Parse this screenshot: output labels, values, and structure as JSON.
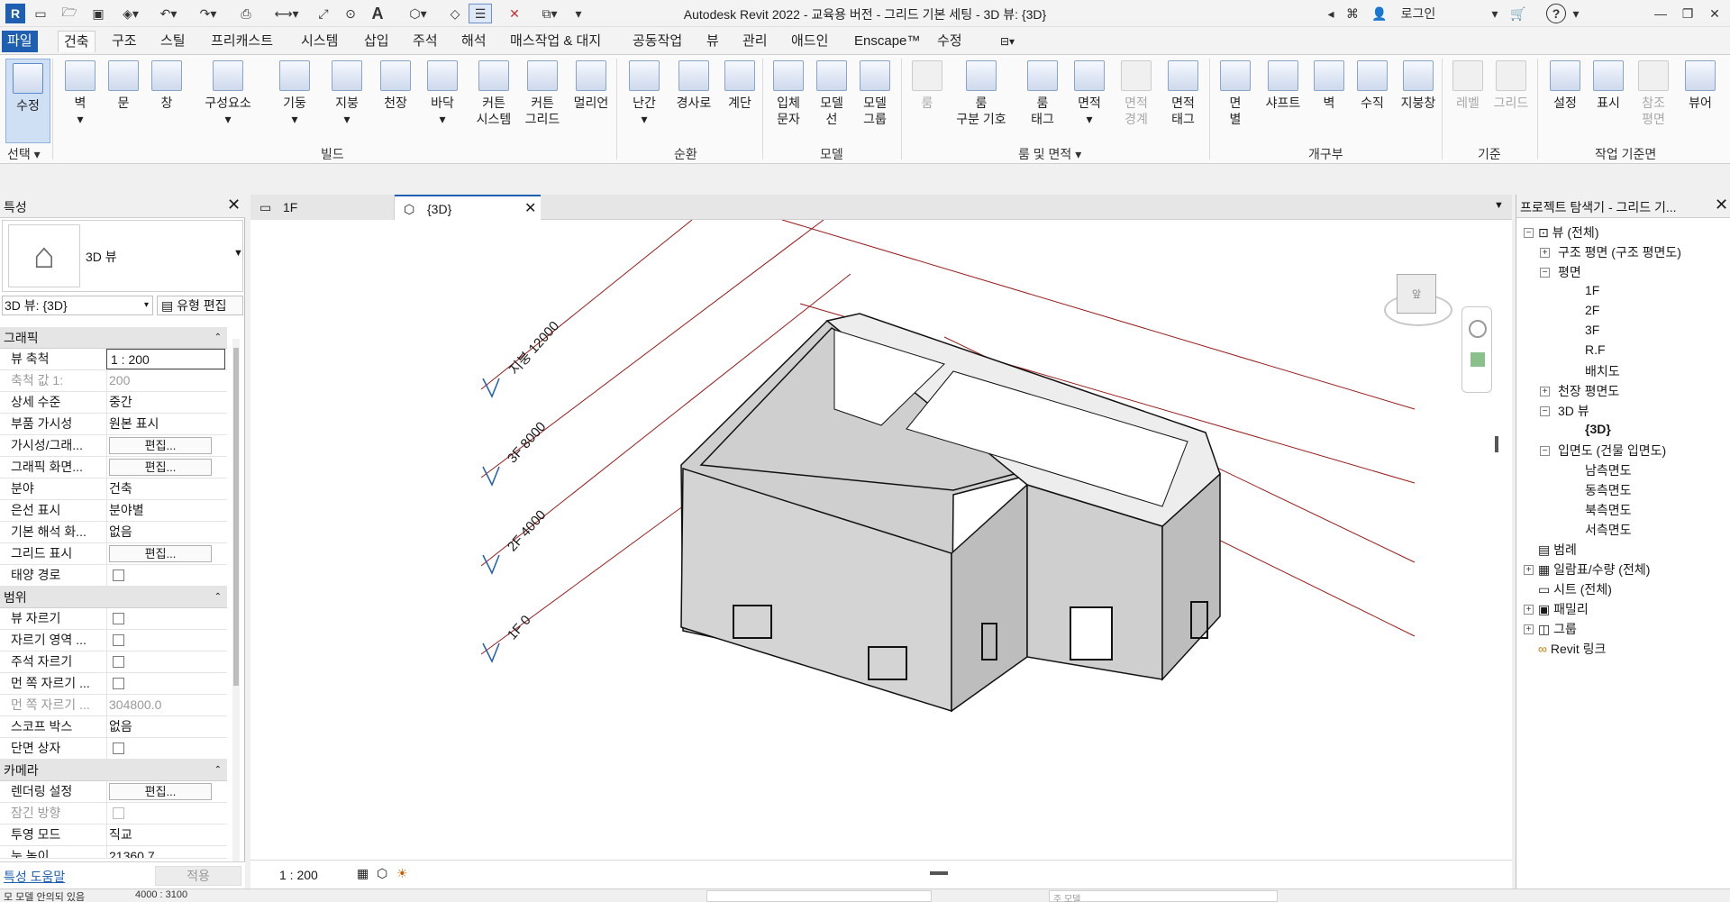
{
  "app": {
    "title": "Autodesk Revit 2022 - 교육용 버전 - 그리드 기본 세팅 - 3D 뷰: {3D}",
    "login_label": "로그인",
    "logo_letter": "R"
  },
  "menu_tabs": [
    {
      "label": "파일"
    },
    {
      "label": "건축"
    },
    {
      "label": "구조"
    },
    {
      "label": "스틸"
    },
    {
      "label": "프리캐스트"
    },
    {
      "label": "시스템"
    },
    {
      "label": "삽입"
    },
    {
      "label": "주석"
    },
    {
      "label": "해석"
    },
    {
      "label": "매스작업 & 대지"
    },
    {
      "label": "공동작업"
    },
    {
      "label": "뷰"
    },
    {
      "label": "관리"
    },
    {
      "label": "애드인"
    },
    {
      "label": "Enscape™"
    },
    {
      "label": "수정"
    }
  ],
  "ribbon": {
    "buttons": [
      {
        "l1": "수정",
        "l2": ""
      },
      {
        "l1": "벽",
        "l2": ""
      },
      {
        "l1": "문",
        "l2": ""
      },
      {
        "l1": "창",
        "l2": ""
      },
      {
        "l1": "구성요소",
        "l2": ""
      },
      {
        "l1": "기둥",
        "l2": ""
      },
      {
        "l1": "지붕",
        "l2": ""
      },
      {
        "l1": "천장",
        "l2": ""
      },
      {
        "l1": "바닥",
        "l2": ""
      },
      {
        "l1": "커튼",
        "l2": "시스템"
      },
      {
        "l1": "커튼",
        "l2": "그리드"
      },
      {
        "l1": "멀리언",
        "l2": ""
      },
      {
        "l1": "난간",
        "l2": ""
      },
      {
        "l1": "경사로",
        "l2": ""
      },
      {
        "l1": "계단",
        "l2": ""
      },
      {
        "l1": "입체",
        "l2": "문자"
      },
      {
        "l1": "모델",
        "l2": "선"
      },
      {
        "l1": "모델",
        "l2": "그룹"
      },
      {
        "l1": "룸",
        "l2": ""
      },
      {
        "l1": "룸",
        "l2": "구분 기호"
      },
      {
        "l1": "룸",
        "l2": "태그"
      },
      {
        "l1": "면적",
        "l2": ""
      },
      {
        "l1": "면적",
        "l2": "경계"
      },
      {
        "l1": "면적",
        "l2": "태그"
      },
      {
        "l1": "면",
        "l2": "별"
      },
      {
        "l1": "샤프트",
        "l2": ""
      },
      {
        "l1": "벽",
        "l2": ""
      },
      {
        "l1": "수직",
        "l2": ""
      },
      {
        "l1": "지붕창",
        "l2": ""
      },
      {
        "l1": "레벨",
        "l2": ""
      },
      {
        "l1": "그리드",
        "l2": ""
      },
      {
        "l1": "설정",
        "l2": ""
      },
      {
        "l1": "표시",
        "l2": ""
      },
      {
        "l1": "참조",
        "l2": "평면"
      },
      {
        "l1": "뷰어",
        "l2": ""
      }
    ],
    "groups": [
      {
        "label": "선택"
      },
      {
        "label": "빌드"
      },
      {
        "label": "순환"
      },
      {
        "label": "모델"
      },
      {
        "label": "룸 및 면적"
      },
      {
        "label": "개구부"
      },
      {
        "label": "기준"
      },
      {
        "label": "작업 기준면"
      }
    ]
  },
  "properties": {
    "title": "특성",
    "type_name": "3D 뷰",
    "view_selector": "3D 뷰: {3D}",
    "edit_type": "유형 편집",
    "sections": [
      {
        "label": "그래픽"
      },
      {
        "label": "범위"
      },
      {
        "label": "카메라"
      }
    ],
    "rows": [
      {
        "k": "뷰 축척",
        "v": "1 : 200"
      },
      {
        "k": "축척 값    1:",
        "v": "200"
      },
      {
        "k": "상세 수준",
        "v": "중간"
      },
      {
        "k": "부품 가시성",
        "v": "원본 표시"
      },
      {
        "k": "가시성/그래...",
        "v": "편집..."
      },
      {
        "k": "그래픽 화면...",
        "v": "편집..."
      },
      {
        "k": "분야",
        "v": "건축"
      },
      {
        "k": "은선 표시",
        "v": "분야별"
      },
      {
        "k": "기본 해석 화...",
        "v": "없음"
      },
      {
        "k": "그리드 표시",
        "v": "편집..."
      },
      {
        "k": "태양 경로",
        "v": ""
      },
      {
        "k": "뷰 자르기",
        "v": ""
      },
      {
        "k": "자르기 영역 ...",
        "v": ""
      },
      {
        "k": "주석 자르기",
        "v": ""
      },
      {
        "k": "먼 쪽 자르기 ...",
        "v": ""
      },
      {
        "k": "먼 쪽 자르기 ...",
        "v": "304800.0"
      },
      {
        "k": "스코프 박스",
        "v": "없음"
      },
      {
        "k": "단면 상자",
        "v": ""
      },
      {
        "k": "렌더링 설정",
        "v": "편집..."
      },
      {
        "k": "잠긴 방향",
        "v": ""
      },
      {
        "k": "투영 모드",
        "v": "직교"
      },
      {
        "k": "눈 높이",
        "v": "21360.7"
      }
    ],
    "help_link": "특성 도움말",
    "apply_button": "적용"
  },
  "view_tabs": [
    {
      "label": "1F"
    },
    {
      "label": "{3D}"
    }
  ],
  "levels": [
    {
      "name": "지붕",
      "elev": "12000"
    },
    {
      "name": "3F",
      "elev": "8000"
    },
    {
      "name": "2F",
      "elev": "4000"
    },
    {
      "name": "1F",
      "elev": "0"
    }
  ],
  "viewcube_label": "앞",
  "view_scale": "1 : 200",
  "browser": {
    "title": "프로젝트 탐색기 - 그리드 기...",
    "items": [
      {
        "label": "뷰 (전체)"
      },
      {
        "label": "구조 평면 (구조 평면도)"
      },
      {
        "label": "평면"
      },
      {
        "label": "1F"
      },
      {
        "label": "2F"
      },
      {
        "label": "3F"
      },
      {
        "label": "R.F"
      },
      {
        "label": "배치도"
      },
      {
        "label": "천장 평면도"
      },
      {
        "label": "3D 뷰"
      },
      {
        "label": "{3D}"
      },
      {
        "label": "입면도 (건물 입면도)"
      },
      {
        "label": "남측면도"
      },
      {
        "label": "동측면도"
      },
      {
        "label": "북측면도"
      },
      {
        "label": "서측면도"
      },
      {
        "label": "범례"
      },
      {
        "label": "일람표/수량 (전체)"
      },
      {
        "label": "시트 (전체)"
      },
      {
        "label": "패밀리"
      },
      {
        "label": "그룹"
      },
      {
        "label": "Revit 링크"
      }
    ]
  },
  "statusbar": {
    "text": "모 모델 안의되 있음",
    "coord": "4000 : 3100",
    "field_placeholder": "주 모델"
  }
}
